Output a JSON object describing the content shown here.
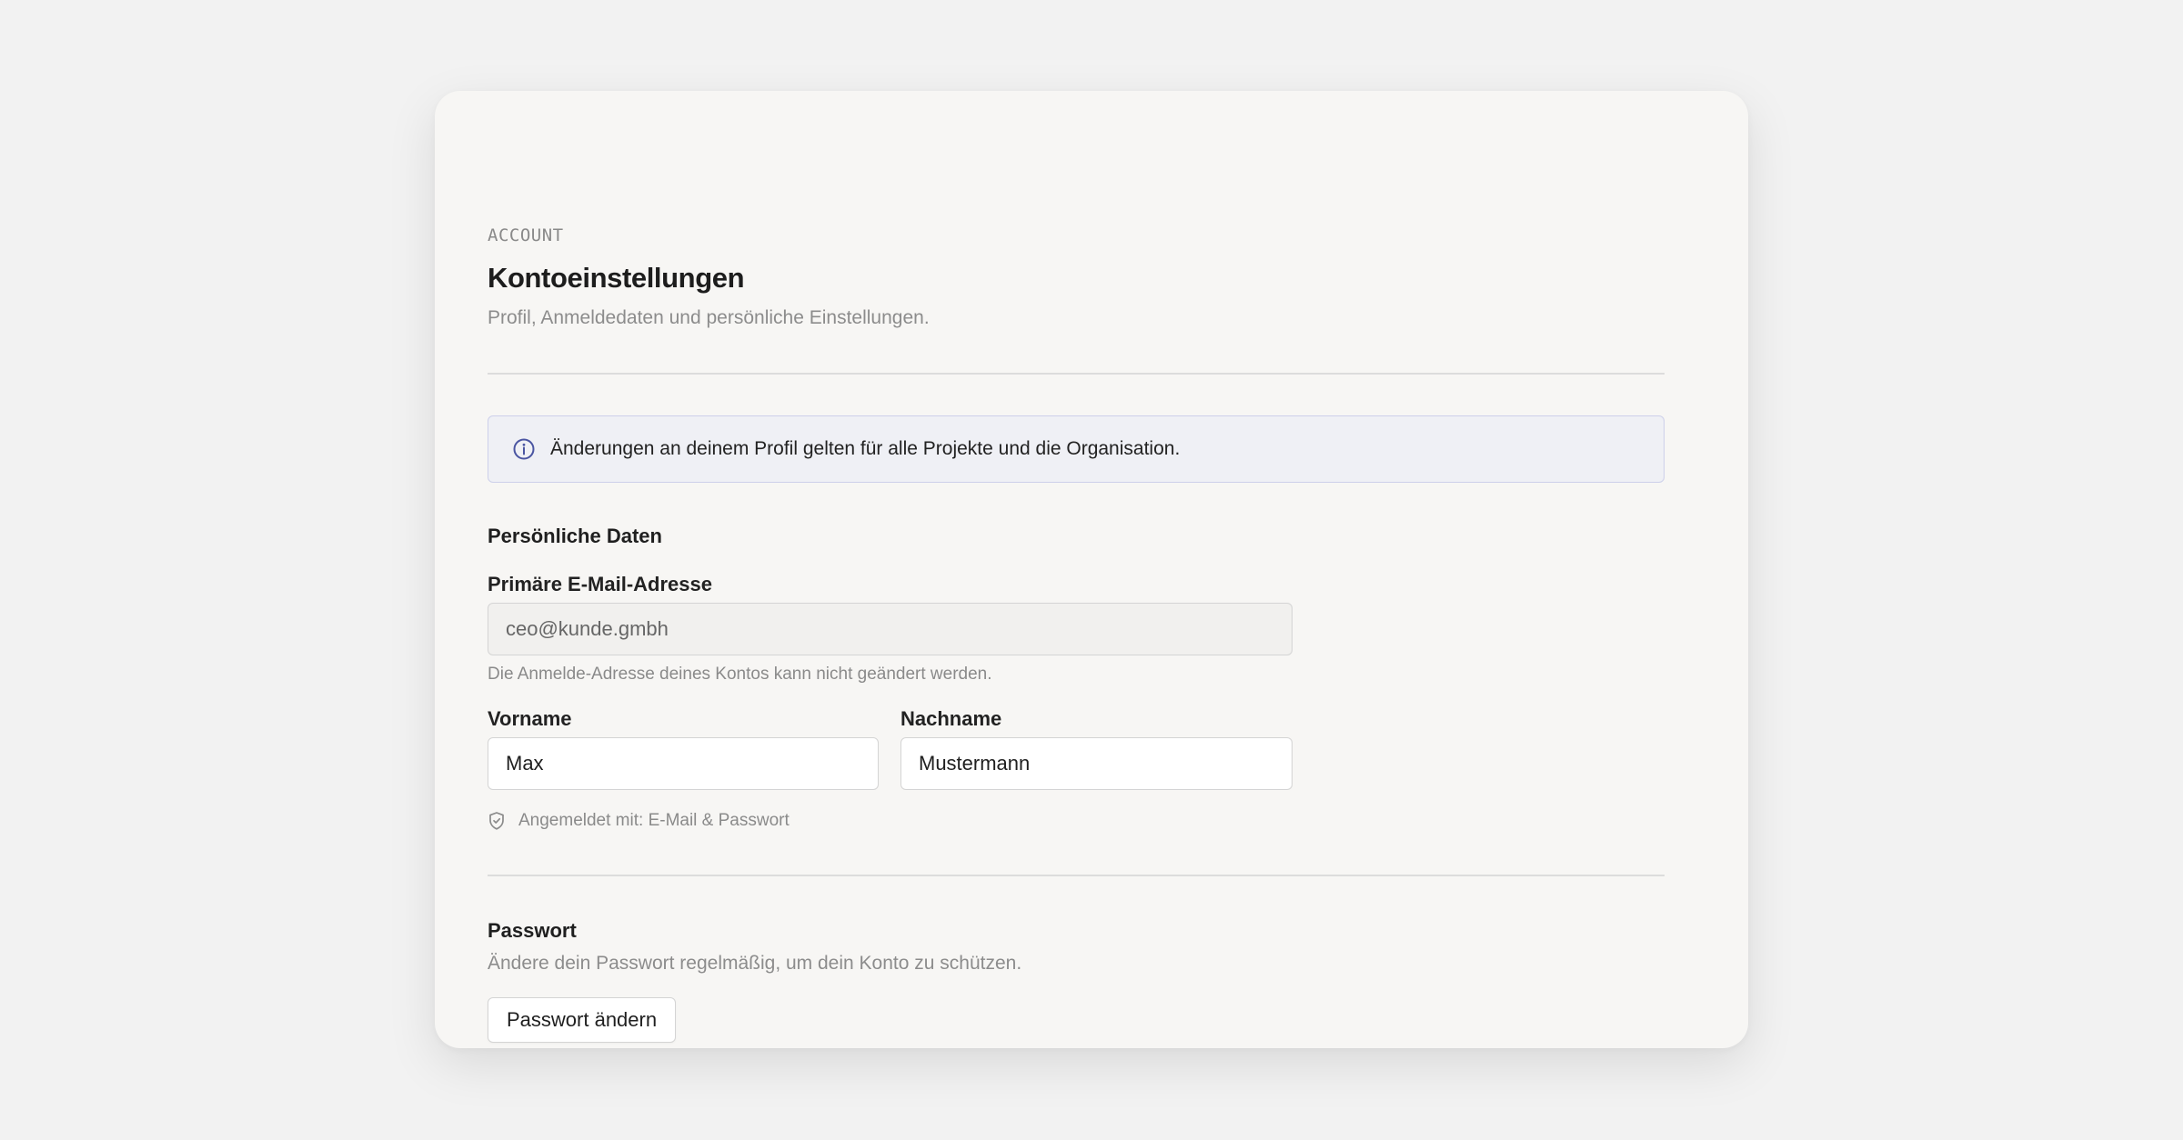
{
  "header": {
    "eyebrow": "ACCOUNT",
    "title": "Kontoeinstellungen",
    "subtitle": "Profil, Anmeldedaten und persönliche Einstellungen."
  },
  "info_banner": {
    "icon": "info-icon",
    "text": "Änderungen an deinem Profil gelten für alle Projekte und die Organisation.",
    "accent_color": "#4a55a2"
  },
  "personal": {
    "heading": "Persönliche Daten",
    "email": {
      "label": "Primäre E-Mail-Adresse",
      "value": "ceo@kunde.gmbh",
      "hint": "Die Anmelde-Adresse deines Kontos kann nicht geändert werden."
    },
    "first_name": {
      "label": "Vorname",
      "value": "Max"
    },
    "last_name": {
      "label": "Nachname",
      "value": "Mustermann"
    },
    "login_method": {
      "icon": "shield-check-icon",
      "text": "Angemeldet mit: E-Mail & Passwort"
    }
  },
  "password": {
    "heading": "Passwort",
    "description": "Ändere dein Passwort regelmäßig, um dein Konto zu schützen.",
    "button_label": "Passwort ändern"
  }
}
